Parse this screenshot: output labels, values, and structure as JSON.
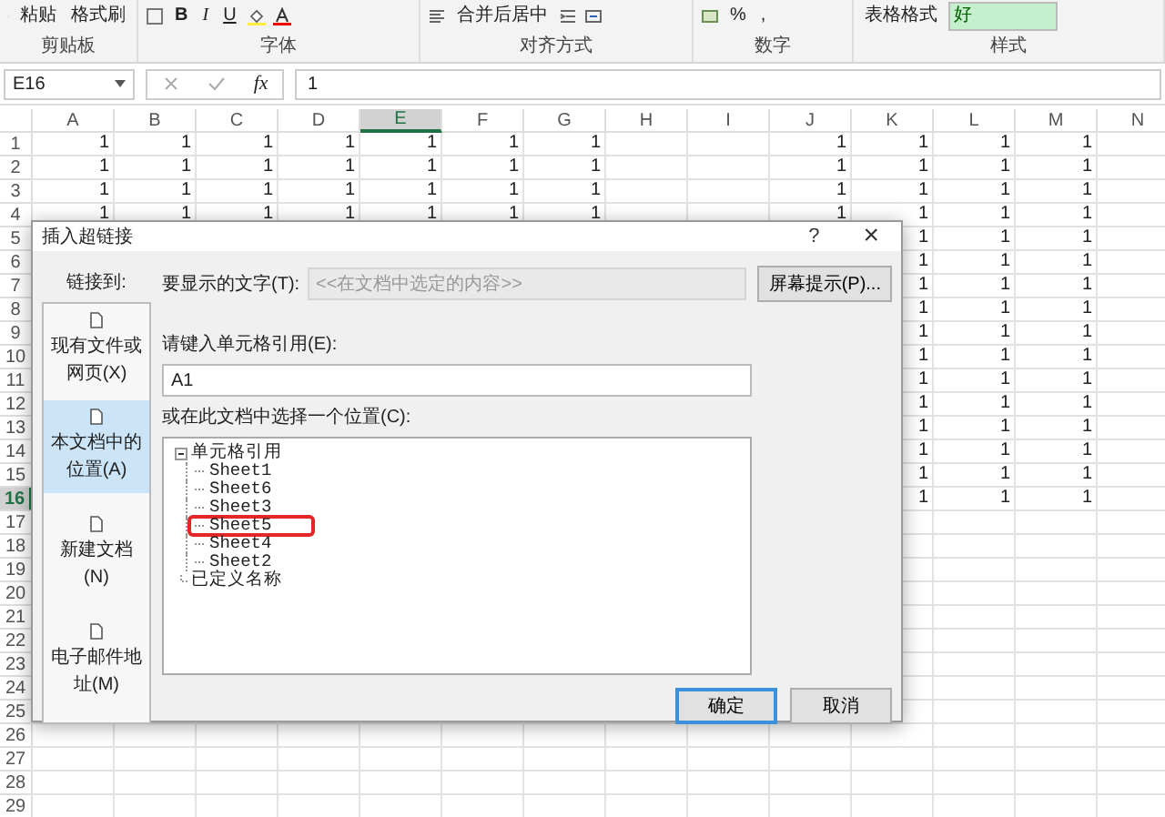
{
  "ribbon": {
    "groups": [
      {
        "label": "剪贴板",
        "items": [
          {
            "kind": "large",
            "label": "粘贴"
          },
          {
            "kind": "small",
            "label": "格式刷"
          }
        ]
      },
      {
        "label": "字体",
        "items": [
          {
            "kind": "bold",
            "label": "B"
          },
          {
            "kind": "italic",
            "label": "I"
          },
          {
            "kind": "underline",
            "label": "U"
          }
        ]
      },
      {
        "label": "对齐方式",
        "items": [
          {
            "kind": "small",
            "label": "合并后居中"
          }
        ]
      },
      {
        "label": "数字",
        "items": [
          {
            "kind": "small",
            "label": "%"
          },
          {
            "kind": "small",
            "label": ","
          }
        ]
      },
      {
        "label": "样式",
        "items": [
          {
            "kind": "small",
            "label": "表格格式"
          },
          {
            "kind": "style",
            "label": "好"
          }
        ]
      }
    ]
  },
  "formula_bar": {
    "name_box": "E16",
    "fx": "fx",
    "value": "1"
  },
  "sheet": {
    "columns": [
      {
        "label": "A",
        "selected": false
      },
      {
        "label": "B",
        "selected": false
      },
      {
        "label": "C",
        "selected": false
      },
      {
        "label": "D",
        "selected": false
      },
      {
        "label": "E",
        "selected": true
      },
      {
        "label": "F",
        "selected": false
      },
      {
        "label": "G",
        "selected": false
      },
      {
        "label": "H",
        "selected": false
      },
      {
        "label": "I",
        "selected": false
      },
      {
        "label": "J",
        "selected": false
      },
      {
        "label": "K",
        "selected": false
      },
      {
        "label": "L",
        "selected": false
      },
      {
        "label": "M",
        "selected": false
      },
      {
        "label": "N",
        "selected": false
      }
    ],
    "rows": [
      {
        "label": "1",
        "selected": false,
        "left_cells": [
          "1",
          "1",
          "1",
          "1",
          "1",
          "1",
          "1"
        ],
        "right_cells": [
          "1",
          "1",
          "1",
          "1"
        ]
      },
      {
        "label": "2",
        "selected": false,
        "left_cells": [
          "1",
          "1",
          "1",
          "1",
          "1",
          "1",
          "1"
        ],
        "right_cells": [
          "1",
          "1",
          "1",
          "1"
        ]
      },
      {
        "label": "3",
        "selected": false,
        "left_cells": [
          "1",
          "1",
          "1",
          "1",
          "1",
          "1",
          "1"
        ],
        "right_cells": [
          "1",
          "1",
          "1",
          "1"
        ]
      },
      {
        "label": "4",
        "selected": false,
        "left_cells": [
          "1",
          "1",
          "1",
          "1",
          "1",
          "1",
          "1"
        ],
        "right_cells": [
          "1",
          "1",
          "1",
          "1"
        ]
      },
      {
        "label": "5",
        "selected": false,
        "right_cells": [
          "1",
          "1",
          "1"
        ]
      },
      {
        "label": "6",
        "selected": false,
        "right_cells": [
          "1",
          "1",
          "1"
        ]
      },
      {
        "label": "7",
        "selected": false,
        "right_cells": [
          "1",
          "1",
          "1"
        ]
      },
      {
        "label": "8",
        "selected": false,
        "right_cells": [
          "1",
          "1",
          "1"
        ]
      },
      {
        "label": "9",
        "selected": false,
        "right_cells": [
          "1",
          "1",
          "1"
        ]
      },
      {
        "label": "10",
        "selected": false,
        "right_cells": [
          "1",
          "1",
          "1"
        ]
      },
      {
        "label": "11",
        "selected": false,
        "right_cells": [
          "1",
          "1",
          "1"
        ]
      },
      {
        "label": "12",
        "selected": false,
        "right_cells": [
          "1",
          "1",
          "1"
        ]
      },
      {
        "label": "13",
        "selected": false,
        "right_cells": [
          "1",
          "1",
          "1"
        ]
      },
      {
        "label": "14",
        "selected": false,
        "right_cells": [
          "1",
          "1",
          "1"
        ]
      },
      {
        "label": "15",
        "selected": false,
        "right_cells": [
          "1",
          "1",
          "1"
        ]
      },
      {
        "label": "16",
        "selected": true,
        "right_cells": [
          "1",
          "1",
          "1"
        ]
      },
      {
        "label": "17",
        "selected": false
      },
      {
        "label": "18",
        "selected": false
      },
      {
        "label": "19",
        "selected": false
      },
      {
        "label": "20",
        "selected": false
      },
      {
        "label": "21",
        "selected": false
      },
      {
        "label": "22",
        "selected": false
      },
      {
        "label": "23",
        "selected": false
      },
      {
        "label": "24",
        "selected": false
      },
      {
        "label": "25",
        "selected": false
      },
      {
        "label": "26",
        "selected": false
      },
      {
        "label": "27",
        "selected": false
      },
      {
        "label": "28",
        "selected": false
      },
      {
        "label": "29",
        "selected": false
      }
    ]
  },
  "dialog": {
    "title": "插入超链接",
    "help": "?",
    "close": "×",
    "link_to_label": "链接到:",
    "link_types": [
      {
        "label": "现有文件或网页(X)",
        "selected": false
      },
      {
        "label": "本文档中的位置(A)",
        "selected": true
      },
      {
        "label": "新建文档(N)",
        "selected": false
      },
      {
        "label": "电子邮件地址(M)",
        "selected": false
      }
    ],
    "display_text": {
      "label": "要显示的文字(T):",
      "placeholder": "<<在文档中选定的内容>>",
      "disabled": true
    },
    "screen_tip_button": "屏幕提示(P)...",
    "cell_reference": {
      "label": "请键入单元格引用(E):",
      "value": "A1"
    },
    "location_label": "或在此文档中选择一个位置(C):",
    "locations": [
      {
        "label": "单元格引用",
        "expanded": true,
        "children": [
          {
            "label": "Sheet1",
            "annotated": false
          },
          {
            "label": "Sheet6",
            "annotated": false
          },
          {
            "label": "Sheet3",
            "annotated": false
          },
          {
            "label": "Sheet5",
            "annotated": true
          },
          {
            "label": "Sheet4",
            "annotated": false
          },
          {
            "label": "Sheet2",
            "annotated": false
          }
        ]
      },
      {
        "label": "已定义名称"
      }
    ],
    "buttons": [
      {
        "label": "确定",
        "default": true
      },
      {
        "label": "取消",
        "default": false
      }
    ]
  }
}
